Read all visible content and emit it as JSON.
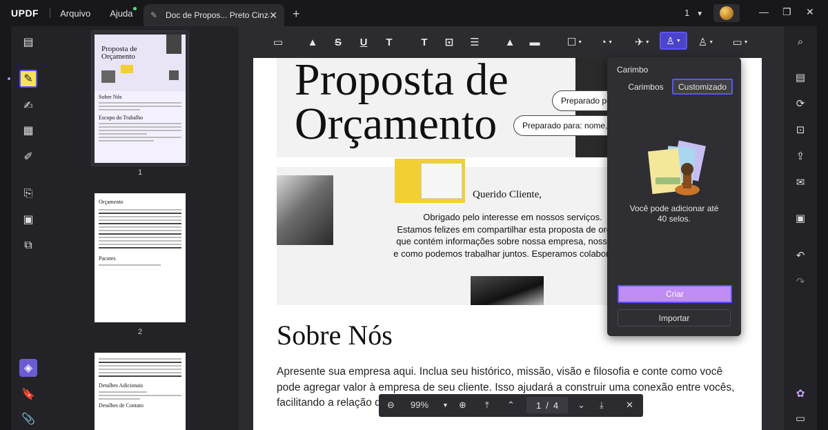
{
  "app": {
    "logo": "UPDF",
    "menu": [
      "Arquivo",
      "Ajuda"
    ],
    "tab_title": "Doc de Propos... Preto Cinza*",
    "page_selector": "1"
  },
  "thumbnails": {
    "page_numbers": [
      "1",
      "2"
    ],
    "page1": {
      "title": "Proposta de Orçamento",
      "section1": "Sobre Nós",
      "section2": "Escopo do Trabalho"
    },
    "page2": {
      "title": "Orçamento",
      "section": "Pacotes"
    },
    "page3": {
      "title": "Detalhes Adicionais",
      "footer": "Detalhes de Contato"
    }
  },
  "document": {
    "hero_title_line1": "Proposta de",
    "hero_title_line2": "Orçamento",
    "pill_prepared_by": "Preparado po",
    "pill_prepared_for": "Preparado para: nome, fu",
    "greeting": "Querido Cliente,",
    "intro_text": "Obrigado pelo interesse em nossos serviços.\nEstamos felizes em compartilhar esta proposta de orçame\nque contém informações sobre nossa empresa, nossos pa\ne como podemos trabalhar juntos. Esperamos colaborar em",
    "about_title": "Sobre Nós",
    "about_body": "Apresente sua empresa aqui. Inclua seu histórico, missão, visão e filosofia e conte como você pode agregar valor à empresa de seu cliente. Isso ajudará a construir uma conexão entre vocês, facilitando a relação d"
  },
  "nav": {
    "zoom": "99%",
    "current_page": "1",
    "separator": "/",
    "total_pages": "4"
  },
  "stamp_popup": {
    "title": "Carimbo",
    "tab_stamps": "Carimbos",
    "tab_custom": "Customizado",
    "message": "Você pode adicionar até 40 selos.",
    "create_button": "Criar",
    "import_button": "Importar"
  },
  "colors": {
    "accent": "#5b55ff",
    "create_button": "#c08cf5",
    "active_sidebar": "#f6e35a"
  }
}
